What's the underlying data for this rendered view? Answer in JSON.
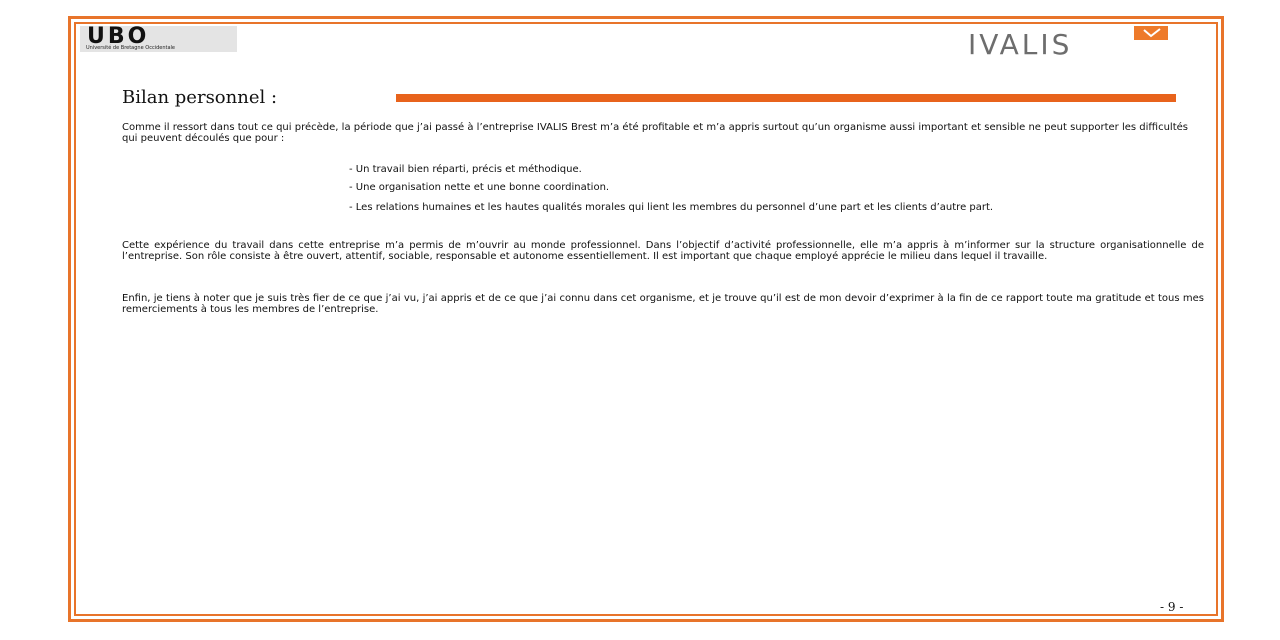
{
  "header": {
    "ubo_logo_text": "UBO",
    "ubo_logo_subtitle": "Université de Bretagne Occidentale",
    "ivalis_logo_text": "IVALIS"
  },
  "section": {
    "title": "Bilan personnel :"
  },
  "body": {
    "paragraph_1": "Comme il ressort dans tout ce qui précède, la période que j’ai passé à l’entreprise IVALIS Brest m’a été profitable et m’a appris surtout qu’un organisme aussi important et sensible ne peut supporter les difficultés qui peuvent découlés que pour :",
    "bullets": [
      "- Un travail bien réparti, précis et méthodique.",
      "- Une organisation nette et une bonne coordination.",
      "- Les relations humaines et les hautes qualités morales qui lient les membres du personnel d’une part et les clients d’autre part."
    ],
    "paragraph_2": "Cette expérience du travail dans cette entreprise m’a permis de m’ouvrir au monde professionnel. Dans l’objectif d’activité professionnelle, elle m’a appris à m’informer sur la structure organisationnelle de l’entreprise. Son rôle consiste à être ouvert, attentif, sociable, responsable et autonome essentiellement. Il est important que chaque employé apprécie le milieu dans lequel il travaille.",
    "paragraph_3": "Enfin, je tiens à noter que je suis très fier de ce que j’ai vu, j’ai appris et de ce que j’ai connu dans cet organisme, et je trouve qu’il est de mon devoir d’exprimer à la fin de ce rapport toute ma gratitude et tous mes remerciements à tous les membres de l’entreprise."
  },
  "footer": {
    "page_number": "- 9 -"
  },
  "colors": {
    "accent_orange": "#e8742a",
    "title_rule": "#e8631c",
    "ivalis_grey": "#6d6d6d"
  }
}
